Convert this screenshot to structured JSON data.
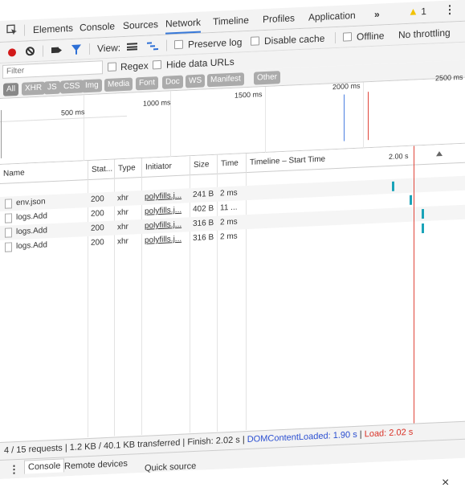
{
  "toolbar_tabs": [
    "Elements",
    "Console",
    "Sources",
    "Network",
    "Timeline",
    "Profiles",
    "Application"
  ],
  "active_tab": "Network",
  "more_tabs": "»",
  "warnings": {
    "icon": "warning-icon",
    "count": "1"
  },
  "network_toolbar": {
    "view_label": "View:",
    "preserve_log": "Preserve log",
    "disable_cache": "Disable cache",
    "offline": "Offline",
    "throttling": "No throttling"
  },
  "filter": {
    "placeholder": "Filter",
    "regex": "Regex",
    "hide_data_urls": "Hide data URLs",
    "types": [
      "All",
      "XHR",
      "JS",
      "CSS",
      "Img",
      "Media",
      "Font",
      "Doc",
      "WS",
      "Manifest",
      "Other"
    ]
  },
  "overview": {
    "ticks": [
      "500 ms",
      "1000 ms",
      "1500 ms",
      "2000 ms",
      "2500 ms"
    ]
  },
  "table": {
    "headers": [
      "Name",
      "Stat...",
      "Type",
      "Initiator",
      "Size",
      "Time",
      "Timeline – Start Time"
    ],
    "timeline_tick": "2.00 s",
    "rows": [
      {
        "name": "env.json",
        "status": "200",
        "type": "xhr",
        "initiator": "polyfills.j...",
        "size": "241 B",
        "time": "2 ms",
        "start": 0.978
      },
      {
        "name": "logs.Add",
        "status": "200",
        "type": "xhr",
        "initiator": "polyfills.j...",
        "size": "402 B",
        "time": "11 ...",
        "start": 1.0
      },
      {
        "name": "logs.Add",
        "status": "200",
        "type": "xhr",
        "initiator": "polyfills.j...",
        "size": "316 B",
        "time": "2 ms",
        "start": 1.015
      },
      {
        "name": "logs.Add",
        "status": "200",
        "type": "xhr",
        "initiator": "polyfills.j...",
        "size": "316 B",
        "time": "2 ms",
        "start": 1.015
      }
    ]
  },
  "status_bar": {
    "requests": "4 / 15 requests",
    "transferred": "1.2 KB / 40.1 KB transferred",
    "finish": "Finish: 2.02 s",
    "dom_content_loaded": "DOMContentLoaded: 1.90 s",
    "load": "Load: 2.02 s",
    "separator": "|"
  },
  "drawer": {
    "tabs": [
      "Console",
      "Remote devices",
      "Quick source"
    ],
    "close": "×"
  },
  "colors": {
    "accent": "#3879d9",
    "record": "#d21a1a",
    "load_line": "#e0453a",
    "dcl_line": "#4a7ee0",
    "bar": "#1aa3b8"
  }
}
